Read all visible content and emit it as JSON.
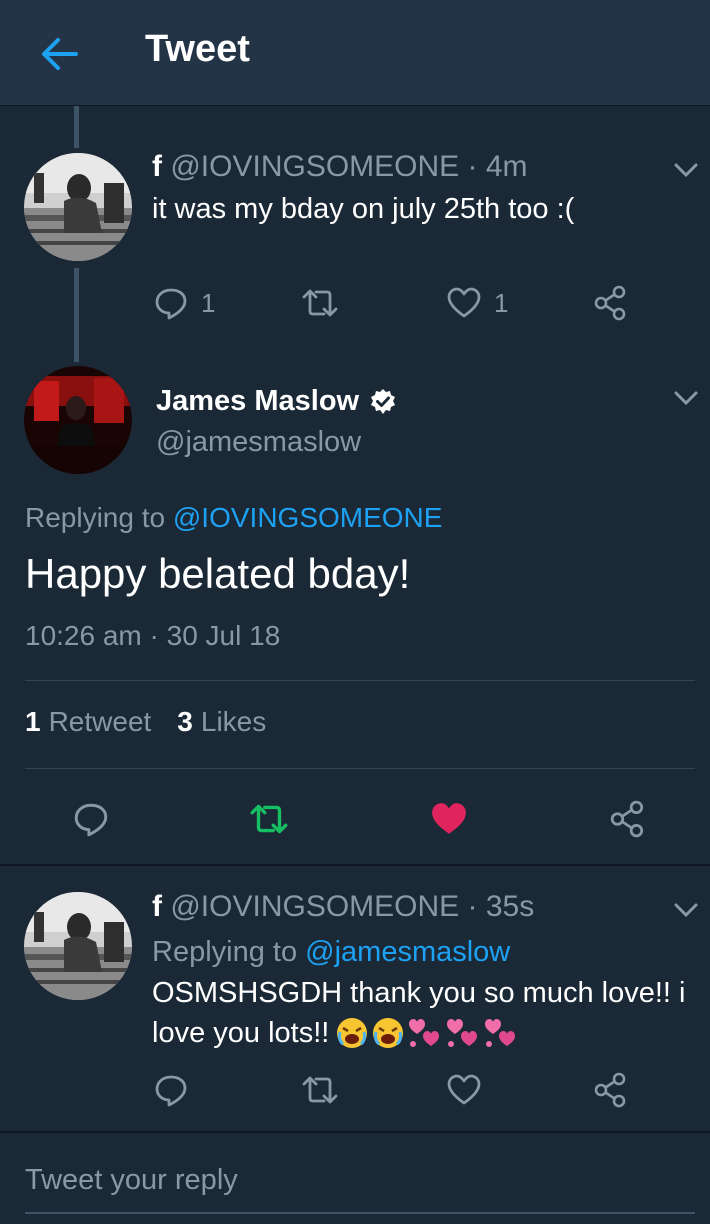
{
  "header": {
    "title": "Tweet"
  },
  "tweet1": {
    "name": "f",
    "handle_time": "@IOVINGSOMEONE · 4m",
    "text": "it was my bday on july 25th too :(",
    "reply_count": "1",
    "like_count": "1"
  },
  "main_tweet": {
    "name": "James Maslow",
    "handle": "@jamesmaslow",
    "replying_prefix": "Replying to",
    "replying_to": "@IOVINGSOMEONE",
    "text": "Happy belated bday!",
    "timestamp": "10:26 am · 30 Jul 18",
    "retweet_count": "1",
    "retweet_label": "Retweet",
    "like_count": "3",
    "like_label": "Likes"
  },
  "tweet2": {
    "name": "f",
    "handle_time": "@IOVINGSOMEONE · 35s",
    "replying_prefix": "Replying to",
    "replying_to": "@jamesmaslow",
    "text_line1": "OSMSHSGDH thank you so much love!! i",
    "text_line2": "love you lots!!"
  },
  "reply_box": {
    "placeholder": "Tweet your reply"
  },
  "colors": {
    "background": "#1b2836",
    "header": "#243447",
    "secondary_text": "#8899a6",
    "link": "#1da1f2",
    "retweet_active": "#17bf63",
    "like_active": "#e0245e"
  },
  "icons": [
    "back-arrow-icon",
    "chevron-down-icon",
    "reply-icon",
    "retweet-icon",
    "like-icon",
    "share-icon",
    "verified-icon"
  ]
}
